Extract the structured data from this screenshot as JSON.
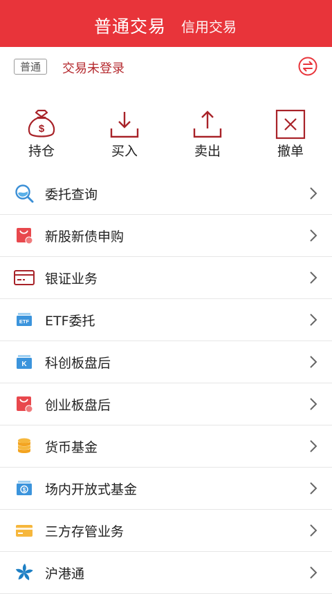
{
  "header": {
    "tab_active": "普通交易",
    "tab_other": "信用交易"
  },
  "status": {
    "badge": "普通",
    "login_text": "交易未登录",
    "swap_icon": "swap-icon"
  },
  "actions": [
    {
      "label": "持仓",
      "icon": "money-bag-icon"
    },
    {
      "label": "买入",
      "icon": "download-arrow-icon"
    },
    {
      "label": "卖出",
      "icon": "upload-arrow-icon"
    },
    {
      "label": "撤单",
      "icon": "cancel-box-icon"
    }
  ],
  "menu": [
    {
      "label": "委托查询",
      "icon": "search-magnifier-icon"
    },
    {
      "label": "新股新债申购",
      "icon": "subscription-bag-icon"
    },
    {
      "label": "银证业务",
      "icon": "bank-card-icon"
    },
    {
      "label": "ETF委托",
      "icon": "etf-tag-icon"
    },
    {
      "label": "科创板盘后",
      "icon": "kcb-k-icon"
    },
    {
      "label": "创业板盘后",
      "icon": "gem-bag-icon"
    },
    {
      "label": "货币基金",
      "icon": "coin-stack-icon"
    },
    {
      "label": "场内开放式基金",
      "icon": "fund-dollar-icon"
    },
    {
      "label": "三方存管业务",
      "icon": "card-yellow-icon"
    },
    {
      "label": "沪港通",
      "icon": "bauhinia-flower-icon"
    }
  ],
  "colors": {
    "primary_red": "#e8343a",
    "dark_red": "#b52a2f"
  }
}
